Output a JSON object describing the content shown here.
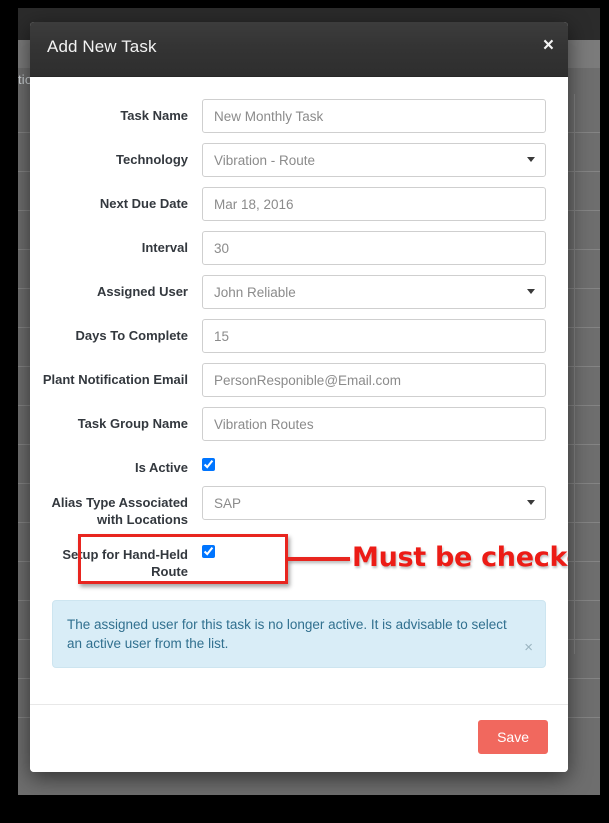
{
  "modal": {
    "title": "Add New Task",
    "close_icon": "close-icon",
    "close_glyph": "×"
  },
  "background": {
    "text_fragment": "tion"
  },
  "form": {
    "fields": [
      {
        "label": "Task Name",
        "type": "text",
        "value": "New Monthly Task"
      },
      {
        "label": "Technology",
        "type": "select",
        "value": "Vibration - Route"
      },
      {
        "label": "Next Due Date",
        "type": "text",
        "value": "Mar 18, 2016"
      },
      {
        "label": "Interval",
        "type": "text",
        "value": "30"
      },
      {
        "label": "Assigned User",
        "type": "select",
        "value": "John Reliable"
      },
      {
        "label": "Days To Complete",
        "type": "text",
        "value": "15"
      },
      {
        "label": "Plant Notification Email",
        "type": "text",
        "value": "PersonResponible@Email.com"
      },
      {
        "label": "Task Group Name",
        "type": "text",
        "value": "Vibration Routes"
      },
      {
        "label": "Is Active",
        "type": "checkbox",
        "checked": true
      },
      {
        "label": "Alias Type Associated with Locations",
        "type": "select",
        "value": "SAP"
      },
      {
        "label": "Setup for Hand-Held Route",
        "type": "checkbox",
        "checked": true
      }
    ]
  },
  "annotation": {
    "text": "Must be checked",
    "color": "#ec1c16"
  },
  "alert": {
    "message": "The assigned user for this task is no longer active. It is advisable to select an active user from the list.",
    "close_glyph": "×",
    "background": "#d9edf7",
    "text_color": "#31708f"
  },
  "footer": {
    "save_label": "Save",
    "save_color": "#f1685e"
  }
}
